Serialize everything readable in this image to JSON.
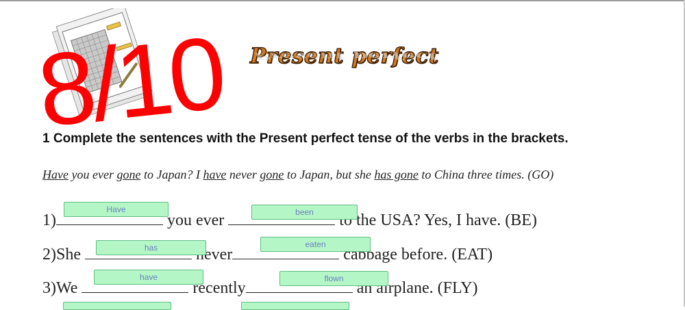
{
  "window": {
    "accent_color": "#d27a1d",
    "score_color": "#ff0000",
    "answer_box_color": "#b5f6c6"
  },
  "header": {
    "title": "Present perfect",
    "score": "8/10"
  },
  "exercise": {
    "instruction": "1 Complete the sentences with the Present perfect tense of the verbs in the brackets.",
    "example": {
      "parts": [
        "Have",
        " you ever ",
        "gone",
        " to Japan? I ",
        "have",
        " never ",
        "gone",
        " to Japan, but she ",
        "has gone",
        " to China three times. (GO)"
      ]
    },
    "questions": [
      {
        "number": "1)",
        "text_a": "you ever",
        "text_b": "to the USA? Yes, I have. (BE)",
        "answer_a": "Have",
        "answer_b": "been"
      },
      {
        "number": "2)",
        "subject": "She",
        "text_a": "never",
        "text_b": "cabbage before. (EAT)",
        "answer_a": "has",
        "answer_b": "eaten"
      },
      {
        "number": "3)",
        "subject": "We",
        "text_a": "recently",
        "text_b": "an airplane. (FLY)",
        "answer_a": "have",
        "answer_b": "flown"
      }
    ]
  }
}
